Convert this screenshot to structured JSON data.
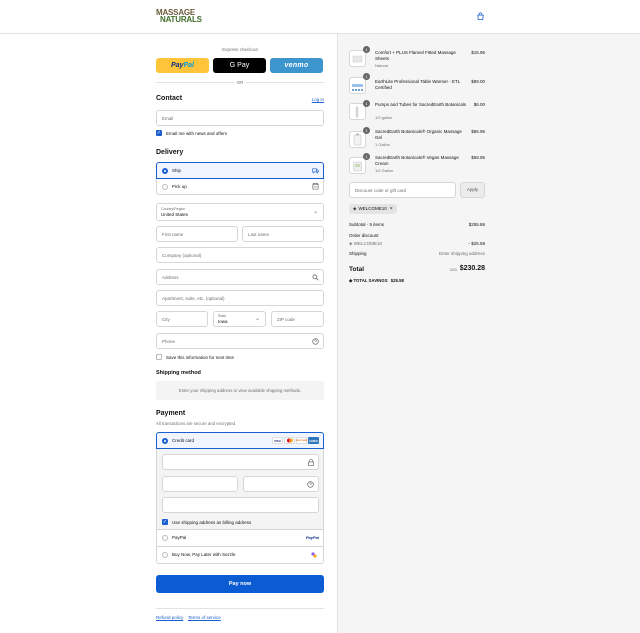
{
  "brand": {
    "line1": "MASSAGE",
    "line2": "NATURALS"
  },
  "express": {
    "title": "Express checkout",
    "paypal_a": "Pay",
    "paypal_b": "Pal",
    "gpay": "G Pay",
    "venmo": "venmo",
    "or": "OR"
  },
  "contact": {
    "title": "Contact",
    "login": "Log in",
    "email_placeholder": "Email",
    "email_news": "Email me with news and offers"
  },
  "delivery": {
    "title": "Delivery",
    "options": [
      {
        "label": "Ship",
        "selected": true,
        "icon": "truck-icon"
      },
      {
        "label": "Pick up",
        "selected": false,
        "icon": "store-icon"
      }
    ],
    "country_label": "Country/Region",
    "country_value": "United States",
    "first_name": "First name",
    "last_name": "Last name",
    "company": "Company (optional)",
    "address": "Address",
    "apartment": "Apartment, suite, etc. (optional)",
    "city": "City",
    "state_label": "State",
    "state_value": "Iowa",
    "zip": "ZIP code",
    "phone": "Phone",
    "save_info": "Save this information for next time"
  },
  "shipping_method": {
    "title": "Shipping method",
    "message": "Enter your shipping address to view available shipping methods."
  },
  "payment": {
    "title": "Payment",
    "subtitle": "All transactions are secure and encrypted.",
    "credit_card": "Credit card",
    "card_logos": [
      "VISA",
      "MC",
      "DISCOVER",
      "AMEX"
    ],
    "billing_same": "Use shipping address as billing address",
    "paypal": "PayPal",
    "paypal_logo": "PayPal",
    "sezzle": "Buy Now, Pay Later with Sezzle"
  },
  "pay_now": "Pay now",
  "footer": {
    "refund": "Refund policy",
    "terms": "Terms of service"
  },
  "order": {
    "items": [
      {
        "qty": "1",
        "name": "Comfort + PLUS Flannel Fitted Massage Sheets",
        "variant": "Natural",
        "price": "$15.96"
      },
      {
        "qty": "1",
        "name": "EarthLite Professional Table Warmer - ETL Certified",
        "variant": "",
        "price": "$89.00"
      },
      {
        "qty": "1",
        "name": "Pumps and Tubes for SacredEarth Botanicals",
        "variant": "1/2 gallon",
        "price": "$6.00"
      },
      {
        "qty": "1",
        "name": "SacredEarth Botanicals® Organic Massage Gel",
        "variant": "1 Gallon",
        "price": "$85.95"
      },
      {
        "qty": "1",
        "name": "SacredEarth Botanicals® Vegan Massage Cream",
        "variant": "1/2 Gallon",
        "price": "$58.95"
      }
    ],
    "discount_placeholder": "Discount code or gift card",
    "apply": "Apply",
    "applied_code": "WELCOME10",
    "subtotal_label": "Subtotal · 5 items",
    "subtotal_value": "$255.86",
    "order_discount_label": "Order discount",
    "discount_code": "WELCOME10",
    "discount_value": "- $25.58",
    "shipping_label": "Shipping",
    "shipping_value": "Enter shipping address",
    "total_label": "Total",
    "currency": "USD",
    "total_value": "$230.28",
    "savings_label": "TOTAL SAVINGS",
    "savings_value": "$25.58"
  },
  "colors": {
    "accent": "#1a5fd0",
    "paynow": "#0b5bd3",
    "paypal_yellow": "#ffc439",
    "venmo_blue": "#3d95ce"
  }
}
